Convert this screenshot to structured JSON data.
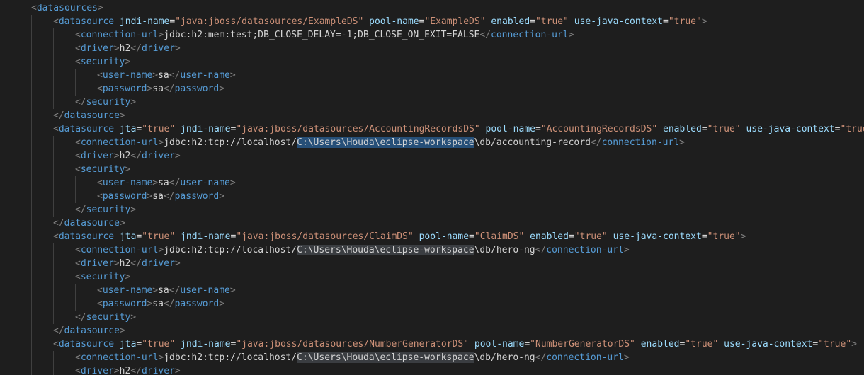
{
  "editor": {
    "lines": [
      [
        [
          "bk",
          "<"
        ],
        [
          "tg",
          "datasources"
        ],
        [
          "bk",
          ">"
        ]
      ],
      [
        [
          "bk",
          "<"
        ],
        [
          "tg",
          "datasource"
        ],
        [
          "tx",
          " "
        ],
        [
          "at",
          "jndi-name"
        ],
        [
          "tx",
          "="
        ],
        [
          "st",
          "\"java:jboss/datasources/ExampleDS\""
        ],
        [
          "tx",
          " "
        ],
        [
          "at",
          "pool-name"
        ],
        [
          "tx",
          "="
        ],
        [
          "st",
          "\"ExampleDS\""
        ],
        [
          "tx",
          " "
        ],
        [
          "at",
          "enabled"
        ],
        [
          "tx",
          "="
        ],
        [
          "st",
          "\"true\""
        ],
        [
          "tx",
          " "
        ],
        [
          "at",
          "use-java-context"
        ],
        [
          "tx",
          "="
        ],
        [
          "st",
          "\"true\""
        ],
        [
          "bk",
          ">"
        ]
      ],
      [
        [
          "bk",
          "<"
        ],
        [
          "tg",
          "connection-url"
        ],
        [
          "bk",
          ">"
        ],
        [
          "tx",
          "jdbc:h2:mem:test;DB_CLOSE_DELAY=-1;DB_CLOSE_ON_EXIT=FALSE"
        ],
        [
          "bk",
          "</"
        ],
        [
          "tg",
          "connection-url"
        ],
        [
          "bk",
          ">"
        ]
      ],
      [
        [
          "bk",
          "<"
        ],
        [
          "tg",
          "driver"
        ],
        [
          "bk",
          ">"
        ],
        [
          "tx",
          "h2"
        ],
        [
          "bk",
          "</"
        ],
        [
          "tg",
          "driver"
        ],
        [
          "bk",
          ">"
        ]
      ],
      [
        [
          "bk",
          "<"
        ],
        [
          "tg",
          "security"
        ],
        [
          "bk",
          ">"
        ]
      ],
      [
        [
          "bk",
          "<"
        ],
        [
          "tg",
          "user-name"
        ],
        [
          "bk",
          ">"
        ],
        [
          "tx",
          "sa"
        ],
        [
          "bk",
          "</"
        ],
        [
          "tg",
          "user-name"
        ],
        [
          "bk",
          ">"
        ]
      ],
      [
        [
          "bk",
          "<"
        ],
        [
          "tg",
          "password"
        ],
        [
          "bk",
          ">"
        ],
        [
          "tx",
          "sa"
        ],
        [
          "bk",
          "</"
        ],
        [
          "tg",
          "password"
        ],
        [
          "bk",
          ">"
        ]
      ],
      [
        [
          "bk",
          "</"
        ],
        [
          "tg",
          "security"
        ],
        [
          "bk",
          ">"
        ]
      ],
      [
        [
          "bk",
          "</"
        ],
        [
          "tg",
          "datasource"
        ],
        [
          "bk",
          ">"
        ]
      ],
      [
        [
          "bk",
          "<"
        ],
        [
          "tg",
          "datasource"
        ],
        [
          "tx",
          " "
        ],
        [
          "at",
          "jta"
        ],
        [
          "tx",
          "="
        ],
        [
          "st",
          "\"true\""
        ],
        [
          "tx",
          " "
        ],
        [
          "at",
          "jndi-name"
        ],
        [
          "tx",
          "="
        ],
        [
          "st",
          "\"java:jboss/datasources/AccountingRecordsDS\""
        ],
        [
          "tx",
          " "
        ],
        [
          "at",
          "pool-name"
        ],
        [
          "tx",
          "="
        ],
        [
          "st",
          "\"AccountingRecordsDS\""
        ],
        [
          "tx",
          " "
        ],
        [
          "at",
          "enabled"
        ],
        [
          "tx",
          "="
        ],
        [
          "st",
          "\"true\""
        ],
        [
          "tx",
          " "
        ],
        [
          "at",
          "use-java-context"
        ],
        [
          "tx",
          "="
        ],
        [
          "st",
          "\"true\""
        ],
        [
          "bk",
          ">"
        ]
      ],
      [
        [
          "bk",
          "<"
        ],
        [
          "tg",
          "connection-url"
        ],
        [
          "bk",
          ">"
        ],
        [
          "tx",
          "jdbc:h2:tcp://localhost/"
        ],
        [
          "hl",
          "C:\\Users\\Houda\\eclipse-workspace"
        ],
        [
          "cur",
          ""
        ],
        [
          "tx",
          "\\db/accounting-record"
        ],
        [
          "bk",
          "</"
        ],
        [
          "tg",
          "connection-url"
        ],
        [
          "bk",
          ">"
        ]
      ],
      [
        [
          "bk",
          "<"
        ],
        [
          "tg",
          "driver"
        ],
        [
          "bk",
          ">"
        ],
        [
          "tx",
          "h2"
        ],
        [
          "bk",
          "</"
        ],
        [
          "tg",
          "driver"
        ],
        [
          "bk",
          ">"
        ]
      ],
      [
        [
          "bk",
          "<"
        ],
        [
          "tg",
          "security"
        ],
        [
          "bk",
          ">"
        ]
      ],
      [
        [
          "bk",
          "<"
        ],
        [
          "tg",
          "user-name"
        ],
        [
          "bk",
          ">"
        ],
        [
          "tx",
          "sa"
        ],
        [
          "bk",
          "</"
        ],
        [
          "tg",
          "user-name"
        ],
        [
          "bk",
          ">"
        ]
      ],
      [
        [
          "bk",
          "<"
        ],
        [
          "tg",
          "password"
        ],
        [
          "bk",
          ">"
        ],
        [
          "tx",
          "sa"
        ],
        [
          "bk",
          "</"
        ],
        [
          "tg",
          "password"
        ],
        [
          "bk",
          ">"
        ]
      ],
      [
        [
          "bk",
          "</"
        ],
        [
          "tg",
          "security"
        ],
        [
          "bk",
          ">"
        ]
      ],
      [
        [
          "bk",
          "</"
        ],
        [
          "tg",
          "datasource"
        ],
        [
          "bk",
          ">"
        ]
      ],
      [
        [
          "bk",
          "<"
        ],
        [
          "tg",
          "datasource"
        ],
        [
          "tx",
          " "
        ],
        [
          "at",
          "jta"
        ],
        [
          "tx",
          "="
        ],
        [
          "st",
          "\"true\""
        ],
        [
          "tx",
          " "
        ],
        [
          "at",
          "jndi-name"
        ],
        [
          "tx",
          "="
        ],
        [
          "st",
          "\"java:jboss/datasources/ClaimDS\""
        ],
        [
          "tx",
          " "
        ],
        [
          "at",
          "pool-name"
        ],
        [
          "tx",
          "="
        ],
        [
          "st",
          "\"ClaimDS\""
        ],
        [
          "tx",
          " "
        ],
        [
          "at",
          "enabled"
        ],
        [
          "tx",
          "="
        ],
        [
          "st",
          "\"true\""
        ],
        [
          "tx",
          " "
        ],
        [
          "at",
          "use-java-context"
        ],
        [
          "tx",
          "="
        ],
        [
          "st",
          "\"true\""
        ],
        [
          "bk",
          ">"
        ]
      ],
      [
        [
          "bk",
          "<"
        ],
        [
          "tg",
          "connection-url"
        ],
        [
          "bk",
          ">"
        ],
        [
          "tx",
          "jdbc:h2:tcp://localhost/"
        ],
        [
          "hl2",
          "C:\\Users\\Houda\\eclipse-workspace"
        ],
        [
          "tx",
          "\\db/hero-ng"
        ],
        [
          "bk",
          "</"
        ],
        [
          "tg",
          "connection-url"
        ],
        [
          "bk",
          ">"
        ]
      ],
      [
        [
          "bk",
          "<"
        ],
        [
          "tg",
          "driver"
        ],
        [
          "bk",
          ">"
        ],
        [
          "tx",
          "h2"
        ],
        [
          "bk",
          "</"
        ],
        [
          "tg",
          "driver"
        ],
        [
          "bk",
          ">"
        ]
      ],
      [
        [
          "bk",
          "<"
        ],
        [
          "tg",
          "security"
        ],
        [
          "bk",
          ">"
        ]
      ],
      [
        [
          "bk",
          "<"
        ],
        [
          "tg",
          "user-name"
        ],
        [
          "bk",
          ">"
        ],
        [
          "tx",
          "sa"
        ],
        [
          "bk",
          "</"
        ],
        [
          "tg",
          "user-name"
        ],
        [
          "bk",
          ">"
        ]
      ],
      [
        [
          "bk",
          "<"
        ],
        [
          "tg",
          "password"
        ],
        [
          "bk",
          ">"
        ],
        [
          "tx",
          "sa"
        ],
        [
          "bk",
          "</"
        ],
        [
          "tg",
          "password"
        ],
        [
          "bk",
          ">"
        ]
      ],
      [
        [
          "bk",
          "</"
        ],
        [
          "tg",
          "security"
        ],
        [
          "bk",
          ">"
        ]
      ],
      [
        [
          "bk",
          "</"
        ],
        [
          "tg",
          "datasource"
        ],
        [
          "bk",
          ">"
        ]
      ],
      [
        [
          "bk",
          "<"
        ],
        [
          "tg",
          "datasource"
        ],
        [
          "tx",
          " "
        ],
        [
          "at",
          "jta"
        ],
        [
          "tx",
          "="
        ],
        [
          "st",
          "\"true\""
        ],
        [
          "tx",
          " "
        ],
        [
          "at",
          "jndi-name"
        ],
        [
          "tx",
          "="
        ],
        [
          "st",
          "\"java:jboss/datasources/NumberGeneratorDS\""
        ],
        [
          "tx",
          " "
        ],
        [
          "at",
          "pool-name"
        ],
        [
          "tx",
          "="
        ],
        [
          "st",
          "\"NumberGeneratorDS\""
        ],
        [
          "tx",
          " "
        ],
        [
          "at",
          "enabled"
        ],
        [
          "tx",
          "="
        ],
        [
          "st",
          "\"true\""
        ],
        [
          "tx",
          " "
        ],
        [
          "at",
          "use-java-context"
        ],
        [
          "tx",
          "="
        ],
        [
          "st",
          "\"true\""
        ],
        [
          "bk",
          ">"
        ]
      ],
      [
        [
          "bk",
          "<"
        ],
        [
          "tg",
          "connection-url"
        ],
        [
          "bk",
          ">"
        ],
        [
          "tx",
          "jdbc:h2:tcp://localhost/"
        ],
        [
          "hl2",
          "C:\\Users\\Houda\\eclipse-workspace"
        ],
        [
          "tx",
          "\\db/hero-ng"
        ],
        [
          "bk",
          "</"
        ],
        [
          "tg",
          "connection-url"
        ],
        [
          "bk",
          ">"
        ]
      ],
      [
        [
          "bk",
          "<"
        ],
        [
          "tg",
          "driver"
        ],
        [
          "bk",
          ">"
        ],
        [
          "tx",
          "h2"
        ],
        [
          "bk",
          "</"
        ],
        [
          "tg",
          "driver"
        ],
        [
          "bk",
          ">"
        ]
      ]
    ],
    "colors": {
      "background": "#1e1e1e",
      "bracket": "#808080",
      "tag": "#569cd6",
      "attribute": "#9cdcfe",
      "string": "#ce9178",
      "text": "#d4d4d4",
      "selection": "#264f78",
      "match_highlight": "#3a3d41"
    }
  }
}
